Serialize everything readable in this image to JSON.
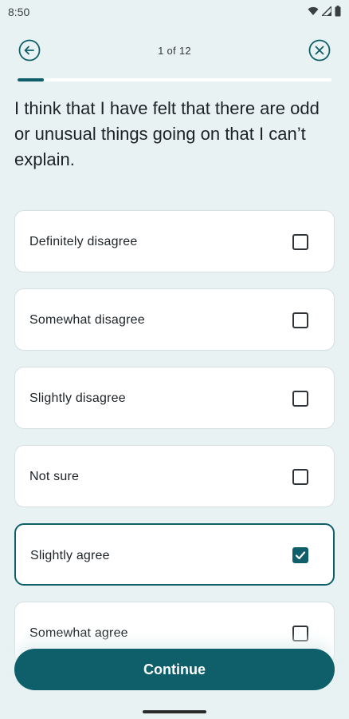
{
  "status_bar": {
    "time": "8:50",
    "icons": [
      "wifi-icon",
      "signal-icon",
      "battery-icon"
    ]
  },
  "header": {
    "progress_text": "1 of 12",
    "back_icon": "back-arrow-circle-icon",
    "close_icon": "close-circle-icon"
  },
  "progress": {
    "current": 1,
    "total": 12
  },
  "question": "I think that I have felt that there are odd or unusual things going on that I can’t explain.",
  "options": [
    {
      "label": "Definitely disagree",
      "checked": false
    },
    {
      "label": "Somewhat disagree",
      "checked": false
    },
    {
      "label": "Slightly disagree",
      "checked": false
    },
    {
      "label": "Not sure",
      "checked": false
    },
    {
      "label": "Slightly agree",
      "checked": true
    },
    {
      "label": "Somewhat agree",
      "checked": false
    }
  ],
  "continue_label": "Continue",
  "colors": {
    "accent": "#0e5f6a",
    "background": "#e8f2f3",
    "card": "#ffffff"
  }
}
